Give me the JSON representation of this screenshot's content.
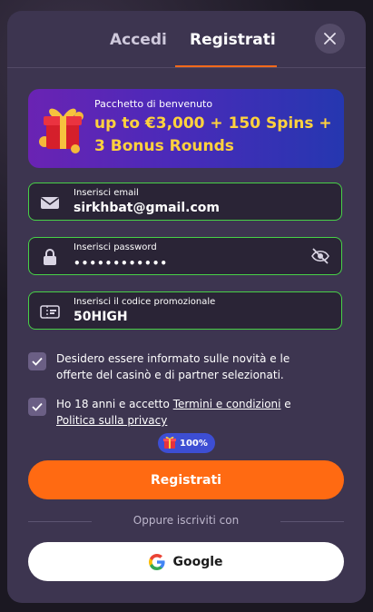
{
  "tabs": {
    "login_label": "Accedi",
    "register_label": "Registrati"
  },
  "banner": {
    "small": "Pacchetto di benvenuto",
    "big": "up to €3,000 + 150 Spins + 3 Bonus Rounds"
  },
  "form": {
    "email": {
      "label": "Inserisci email",
      "value": "sirkhbat@gmail.com"
    },
    "password": {
      "label": "Inserisci password",
      "value": "••••••••••••"
    },
    "promo": {
      "label": "Inserisci il codice promozionale",
      "value": "50HIGH"
    }
  },
  "consents": {
    "marketing": "Desidero essere informato sulle novità e le offerte del casinò e di partner selezionati.",
    "terms_prefix": "Ho 18 anni e accetto",
    "terms_link": "Termini e condizioni",
    "terms_mid": "e",
    "privacy_link": "Politica sulla privacy"
  },
  "badge": {
    "text": "100%"
  },
  "cta": {
    "label": "Registrati"
  },
  "divider": {
    "text": "Oppure iscriviti con"
  },
  "google": {
    "label": "Google"
  },
  "colors": {
    "accent": "#ff6a12",
    "success": "#48d147",
    "modal": "#3d3550",
    "banner_text": "#ffd23d"
  }
}
